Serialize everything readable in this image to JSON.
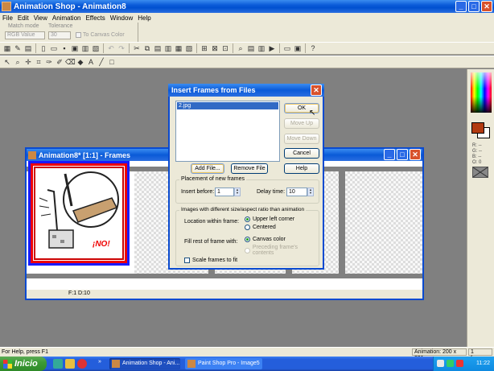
{
  "app": {
    "title": "Animation Shop - Animation8",
    "min": "_",
    "max": "□",
    "close": "✕"
  },
  "menu": [
    "File",
    "Edit",
    "View",
    "Animation",
    "Effects",
    "Window",
    "Help"
  ],
  "tool_options": {
    "match_mode_label": "Match mode",
    "match_mode_value": "RGB Value",
    "tolerance_label": "Tolerance",
    "tolerance_value": "30",
    "to_canvas_color": "To Canvas Color"
  },
  "frames_window": {
    "title": "Animation8* [1:1] - Frames",
    "status": "F:1   D:10",
    "frame_caption": "¡NO!"
  },
  "dialog": {
    "title": "Insert Frames from Files",
    "file_item": "2.jpg",
    "ok": "OK",
    "move_up": "Move Up",
    "move_down": "Move Down",
    "cancel": "Cancel",
    "add_file": "Add File...",
    "remove_file": "Remove File",
    "help": "Help",
    "placement_group": "Placement of new frames",
    "insert_before_label": "Insert before:",
    "insert_before_value": "1",
    "delay_time_label": "Delay time:",
    "delay_time_value": "10",
    "images_group": "Images with different size/aspect ratio than animation",
    "location_label": "Location within frame:",
    "upper_left": "Upper left corner",
    "centered": "Centered",
    "fill_label": "Fill rest of frame with:",
    "canvas_color": "Canvas color",
    "preceding": "Preceding frame's contents",
    "scale_frames": "Scale frames to fit"
  },
  "color_panel": {
    "values": [
      "R: --",
      "G: --",
      "B: --",
      "O: 0"
    ],
    "foreground": "#b23a10",
    "background": "#ffffff"
  },
  "status_bar": {
    "help": "For Help, press F1",
    "animation": "Animation: 200 x 231",
    "frames": "1 frames"
  },
  "taskbar": {
    "start": "Inicio",
    "tasks": [
      "Animation Shop - Ani...",
      "Paint Shop Pro - Image5"
    ],
    "clock": "11:22"
  }
}
